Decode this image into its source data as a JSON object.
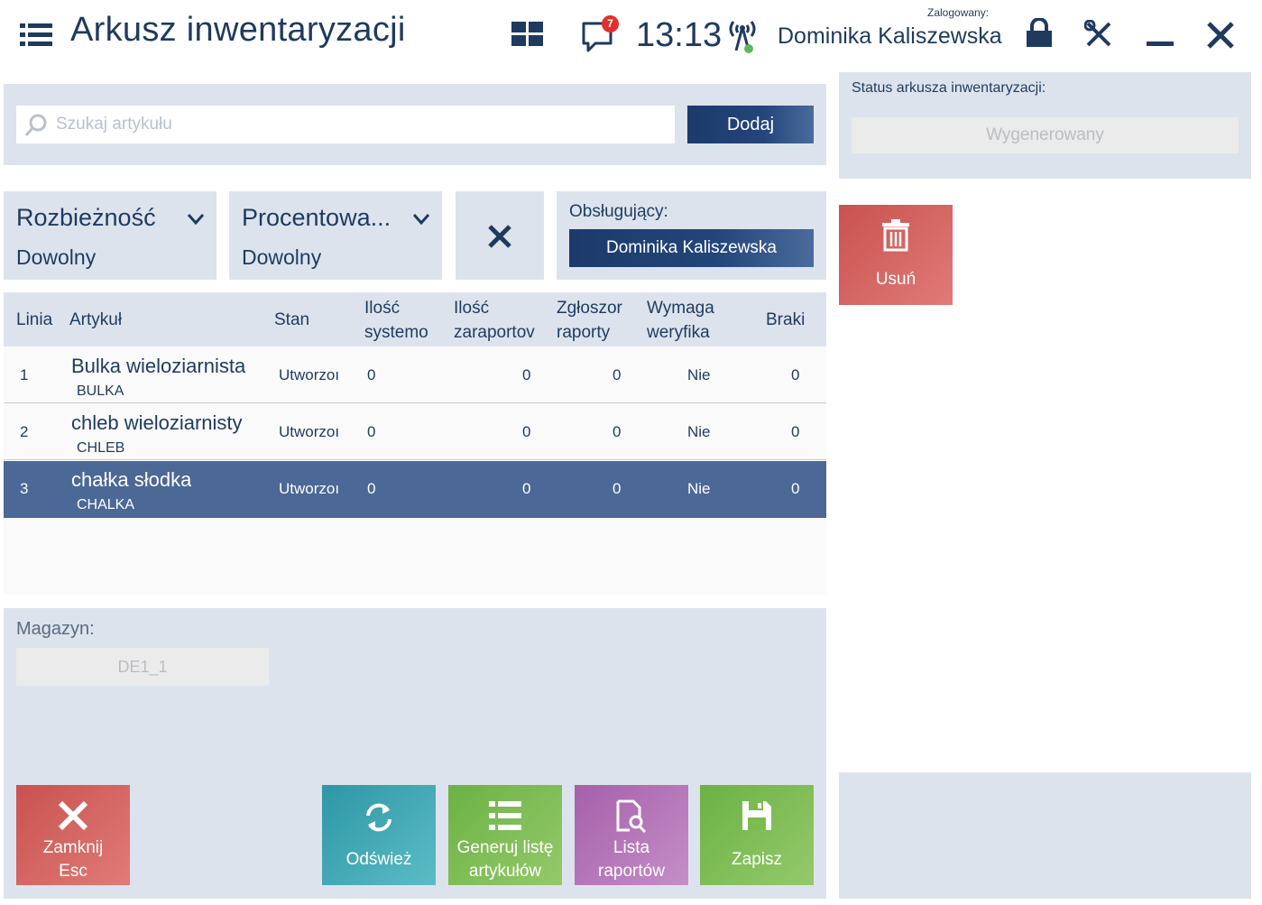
{
  "header": {
    "title": "Arkusz inwentaryzacji",
    "clock": "13:13",
    "notifications_count": "7",
    "logged_label": "Zalogowany:",
    "logged_user": "Dominika Kaliszewska"
  },
  "search": {
    "placeholder": "Szukaj artykułu",
    "add_label": "Dodaj"
  },
  "filters": {
    "discrepancy": {
      "name": "Rozbieżność",
      "value": "Dowolny"
    },
    "percent": {
      "name": "Procentowa...",
      "value": "Dowolny"
    }
  },
  "handler": {
    "label": "Obsługujący:",
    "value": "Dominika Kaliszewska"
  },
  "status": {
    "label": "Status arkusza inwentaryzacji:",
    "value": "Wygenerowany"
  },
  "delete_button": {
    "label": "Usuń"
  },
  "table": {
    "columns": [
      {
        "line1": "Linia",
        "line2": ""
      },
      {
        "line1": "Artykuł",
        "line2": ""
      },
      {
        "line1": "Stan",
        "line2": ""
      },
      {
        "line1": "Ilość",
        "line2": "systemo"
      },
      {
        "line1": "Ilość",
        "line2": "zaraportov"
      },
      {
        "line1": "Zgłoszor",
        "line2": "raporty"
      },
      {
        "line1": "Wymaga",
        "line2": "weryfika"
      },
      {
        "line1": "Braki",
        "line2": ""
      }
    ],
    "rows": [
      {
        "line": "1",
        "name": "Bulka wieloziarnista",
        "code": "BULKA",
        "status": "Utworzoı",
        "system_qty": "0",
        "reported_qty": "0",
        "reports": "0",
        "verify": "Nie",
        "missing": "0"
      },
      {
        "line": "2",
        "name": "chleb wieloziarnisty",
        "code": "CHLEB",
        "status": "Utworzoı",
        "system_qty": "0",
        "reported_qty": "0",
        "reports": "0",
        "verify": "Nie",
        "missing": "0"
      },
      {
        "line": "3",
        "name": "chałka słodka",
        "code": "CHALKA",
        "status": "Utworzoı",
        "system_qty": "0",
        "reported_qty": "0",
        "reports": "0",
        "verify": "Nie",
        "missing": "0"
      }
    ],
    "selected_row": 3
  },
  "warehouse": {
    "label": "Magazyn:",
    "value": "DE1_1"
  },
  "bottom_buttons": {
    "close": {
      "line1": "Zamknij",
      "line2": "Esc"
    },
    "refresh": {
      "line1": "Odśwież"
    },
    "generate": {
      "line1": "Generuj listę",
      "line2": "artykułów"
    },
    "reports": {
      "line1": "Lista",
      "line2": "raportów"
    },
    "save": {
      "line1": "Zapisz"
    }
  },
  "colors": {
    "navy": "#1f3a5f",
    "panel": "#dde3ed",
    "selected_row": "#4b6896",
    "red": "#d9534f",
    "teal": "#3aa4b0",
    "green": "#7dbb4f",
    "purple": "#b074b4"
  },
  "icons": [
    "menu-icon",
    "tiles-icon",
    "chat-icon",
    "signal-icon",
    "lock-icon",
    "tools-icon",
    "minimize-icon",
    "close-icon",
    "search-icon",
    "chevron-down-icon",
    "clear-filter-icon",
    "trash-icon",
    "refresh-icon",
    "list-icon",
    "report-search-icon",
    "save-icon"
  ]
}
